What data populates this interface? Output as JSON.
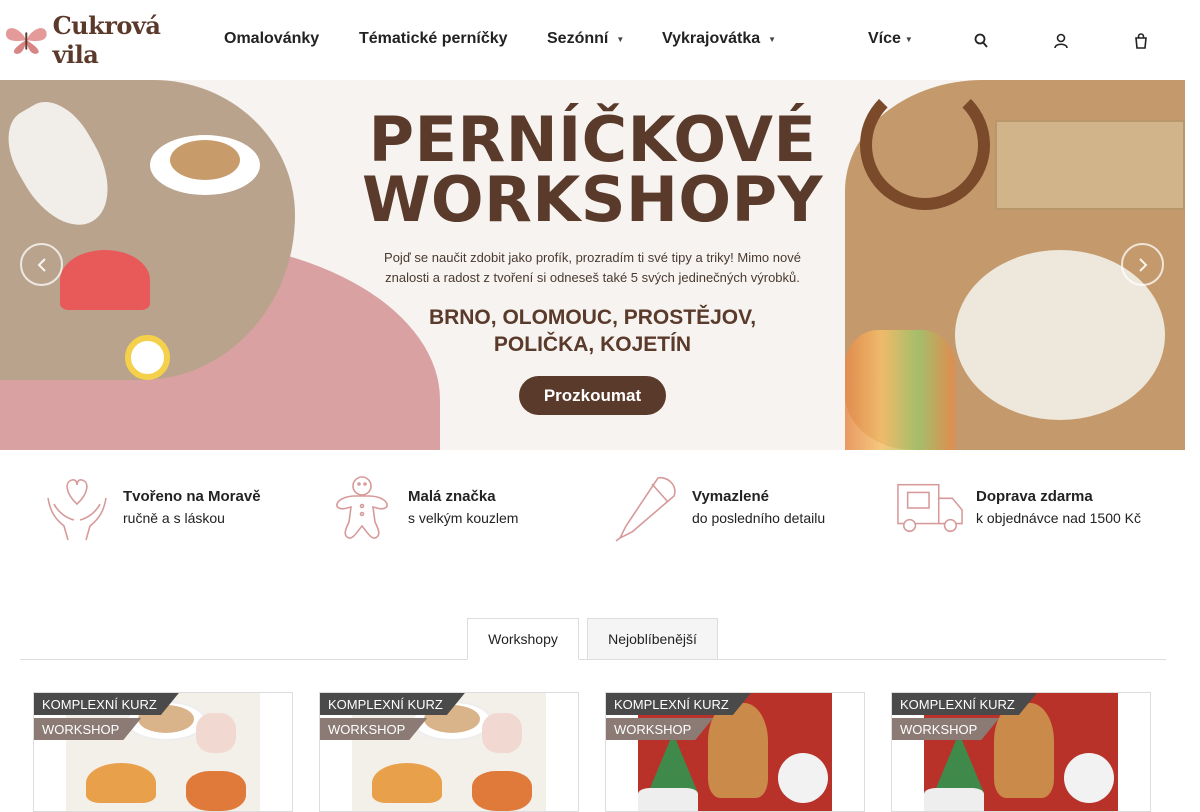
{
  "brand": {
    "name": "Cukrová vila"
  },
  "nav": [
    {
      "label": "Omalovánky"
    },
    {
      "label": "Tématické perníčky"
    },
    {
      "label": "Sezónní"
    },
    {
      "label": "Vykrajovátka"
    },
    {
      "label": "Více"
    }
  ],
  "header_icons": [
    "search-icon",
    "user-icon",
    "cart-icon"
  ],
  "hero": {
    "title_line1": "PERNÍČKOVÉ",
    "title_line2": "WORKSHOPY",
    "subtitle_line1": "Pojď se naučit zdobit jako profík, prozradím ti své tipy a triky! Mimo nové",
    "subtitle_line2": "znalosti a radost z tvoření si odneseš také 5 svých jedinečných výrobků.",
    "cities_line1": "BRNO, OLOMOUC, PROSTĚJOV,",
    "cities_line2": "POLIČKA, KOJETÍN",
    "cta": "Prozkoumat"
  },
  "features": [
    {
      "title": "Tvořeno na Moravě",
      "desc": "ručně a s láskou",
      "icon": "heart-hands-icon"
    },
    {
      "title": "Malá značka",
      "desc": "s velkým kouzlem",
      "icon": "gingerbread-man-icon"
    },
    {
      "title": "Vymazlené",
      "desc": "do posledního detailu",
      "icon": "piping-bag-icon"
    },
    {
      "title": "Doprava zdarma",
      "desc": "k objednávce nad 1500 Kč",
      "icon": "delivery-truck-icon"
    }
  ],
  "tabs": [
    {
      "label": "Workshopy",
      "active": true
    },
    {
      "label": "Nejoblíbenější",
      "active": false
    }
  ],
  "products": [
    {
      "badge1": "KOMPLEXNÍ KURZ",
      "badge2": "WORKSHOP",
      "image": "coffee-cookies"
    },
    {
      "badge1": "KOMPLEXNÍ KURZ",
      "badge2": "WORKSHOP",
      "image": "coffee-cookies"
    },
    {
      "badge1": "KOMPLEXNÍ KURZ",
      "badge2": "WORKSHOP",
      "image": "christmas-gingerbread"
    },
    {
      "badge1": "KOMPLEXNÍ KURZ",
      "badge2": "WORKSHOP",
      "image": "christmas-gingerbread"
    }
  ],
  "colors": {
    "brand_brown": "#5a3a2a",
    "hero_pink": "#d9a1a1",
    "badge_dark": "#4a4a4a",
    "badge_taupe": "#8b7b74"
  }
}
